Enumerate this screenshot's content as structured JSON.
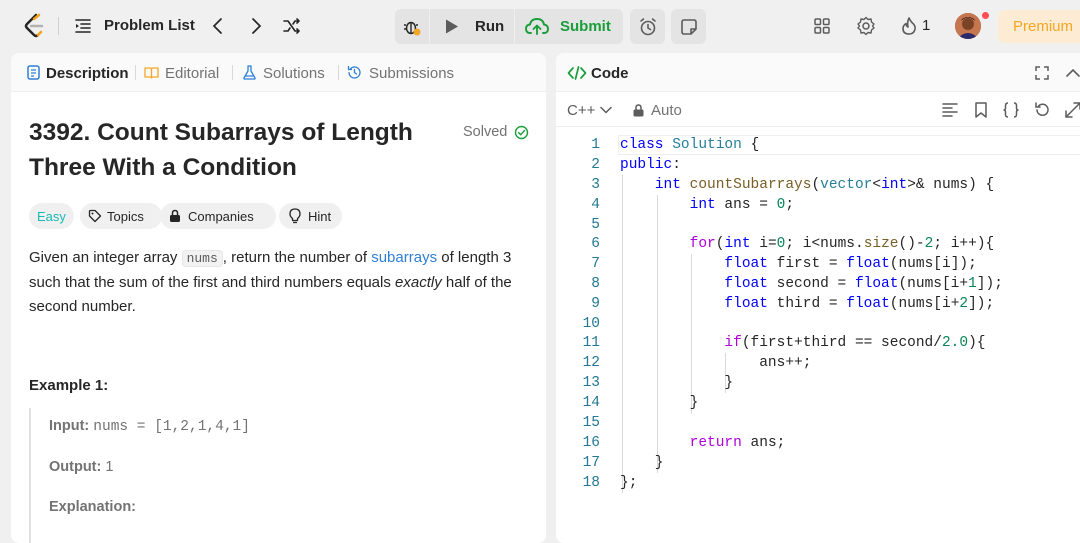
{
  "topbar": {
    "problem_list": "Problem List",
    "run": "Run",
    "submit": "Submit",
    "streak": "1",
    "premium": "Premium"
  },
  "tabs": {
    "description": "Description",
    "editorial": "Editorial",
    "solutions": "Solutions",
    "submissions": "Submissions"
  },
  "problem": {
    "title": "3392. Count Subarrays of Length Three With a Condition",
    "status": "Solved",
    "difficulty": "Easy",
    "tags": [
      "Topics",
      "Companies",
      "Hint"
    ],
    "desc_1": "Given an integer array ",
    "desc_code": "nums",
    "desc_2": ", return the number of ",
    "desc_link": "subarrays",
    "desc_3": " of length 3 such that the sum of the first and third numbers equals ",
    "desc_em": "exactly",
    "desc_4": " half of the second number."
  },
  "example": {
    "title": "Example 1:",
    "input_label": "Input:",
    "input_value": "nums = [1,2,1,4,1]",
    "output_label": "Output:",
    "output_value": "1",
    "explanation_label": "Explanation:"
  },
  "code": {
    "panel_title": "Code",
    "language": "C++",
    "mode": "Auto",
    "line_numbers": [
      "1",
      "2",
      "3",
      "4",
      "5",
      "6",
      "7",
      "8",
      "9",
      "10",
      "11",
      "12",
      "13",
      "14",
      "15",
      "16",
      "17",
      "18"
    ]
  },
  "colors": {
    "accent_green": "#1a9e3a",
    "premium_text": "#f5a623",
    "easy": "#1cb8b8",
    "link": "#2f7fd6"
  },
  "icons": [
    "leetcode-logo-icon",
    "list-icon",
    "chevron-left-icon",
    "chevron-right-icon",
    "shuffle-icon",
    "debug-icon",
    "play-icon",
    "cloud-upload-icon",
    "alarm-icon",
    "note-icon",
    "layout-icon",
    "gear-icon",
    "fire-icon",
    "description-icon",
    "book-icon",
    "flask-icon",
    "history-icon",
    "check-circle-icon",
    "tag-icon",
    "lock-icon",
    "bulb-icon",
    "code-icon",
    "expand-icon",
    "collapse-icon",
    "format-icon",
    "bookmark-icon",
    "braces-icon",
    "undo-icon"
  ]
}
